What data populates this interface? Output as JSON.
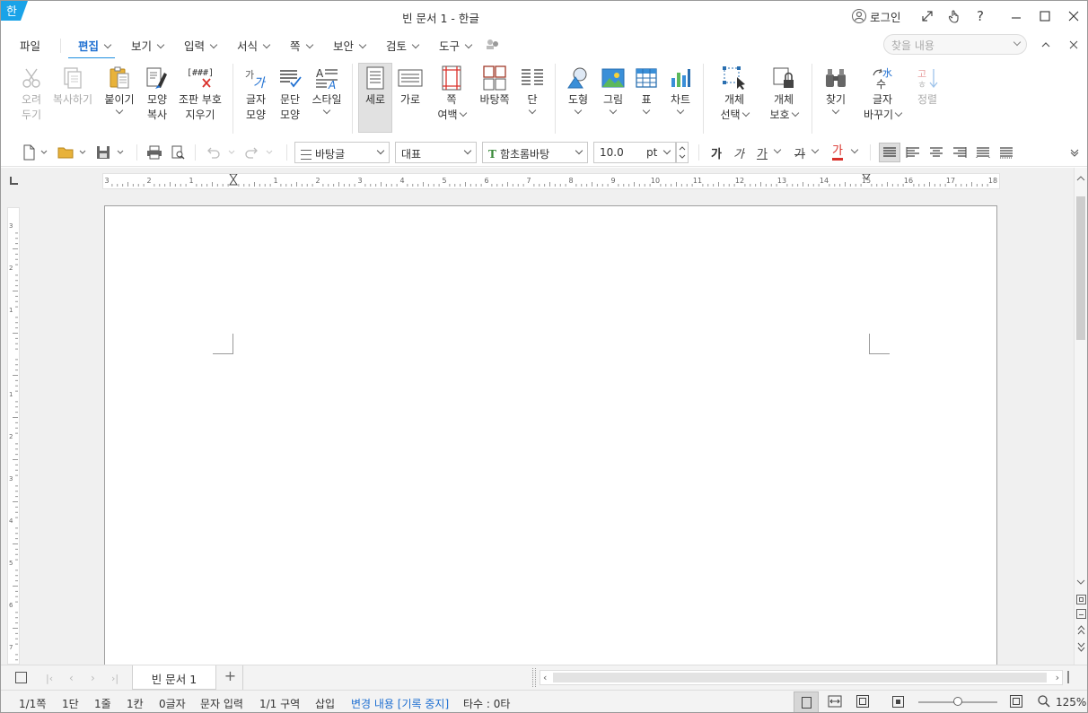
{
  "app": {
    "title": "빈 문서 1 - 한글",
    "logo_glyph": "한",
    "login_label": "로그인"
  },
  "menu": {
    "file": "파일",
    "edit": "편집",
    "view": "보기",
    "input": "입력",
    "format": "서식",
    "page": "쪽",
    "security": "보안",
    "review": "검토",
    "tools": "도구"
  },
  "search": {
    "placeholder": "찾을 내용"
  },
  "ribbon": {
    "cut": [
      "오려",
      "두기"
    ],
    "copy": "복사하기",
    "paste": "붙이기",
    "format_copy": [
      "모양",
      "복사"
    ],
    "clear_marks": [
      "조판 부호",
      "지우기"
    ],
    "char_shape": [
      "글자",
      "모양"
    ],
    "para_shape": [
      "문단",
      "모양"
    ],
    "style": "스타일",
    "portrait": "세로",
    "landscape": "가로",
    "margins": [
      "쪽",
      "여백"
    ],
    "page_border": "바탕쪽",
    "columns": "단",
    "shape": "도형",
    "picture": "그림",
    "table": "표",
    "chart": "차트",
    "object_select": [
      "개체",
      "선택"
    ],
    "object_protect": [
      "개체",
      "보호"
    ],
    "find": "찾기",
    "replace": [
      "글자",
      "바꾸기"
    ],
    "sort": "정렬"
  },
  "toolbar": {
    "style_value": "바탕글",
    "lang_value": "대표",
    "font_value": "함초롬바탕",
    "size_value": "10.0",
    "size_unit": "pt",
    "bold_glyph": "가",
    "italic_glyph": "가",
    "underline_glyph": "가",
    "strike_glyph": "가",
    "color_glyph": "가"
  },
  "ruler": {
    "h_labels": [
      "3",
      "2",
      "1",
      "",
      "1",
      "2",
      "3",
      "4",
      "5",
      "6",
      "7",
      "8",
      "9",
      "10",
      "11",
      "12",
      "13",
      "14",
      "15",
      "16",
      "17",
      "18"
    ],
    "v_labels": [
      "3",
      "2",
      "1",
      "",
      "1",
      "2",
      "3",
      "4",
      "5",
      "6",
      "7"
    ]
  },
  "tabs": {
    "doc_tab": "빈 문서 1",
    "add": "+"
  },
  "status": {
    "page": "1/1쪽",
    "column": "1단",
    "line": "1줄",
    "col": "1칸",
    "chars": "0글자",
    "input_mode": "문자 입력",
    "section": "1/1 구역",
    "insert": "삽입",
    "track": "변경 내용 [기록 중지]",
    "typing": "타수 : 0타",
    "zoom": "125%",
    "zoom_fraction": 0.5
  },
  "colors": {
    "accent": "#1e8fe0",
    "logo": "#1aa3e8",
    "track_text": "#1e6fd1"
  }
}
